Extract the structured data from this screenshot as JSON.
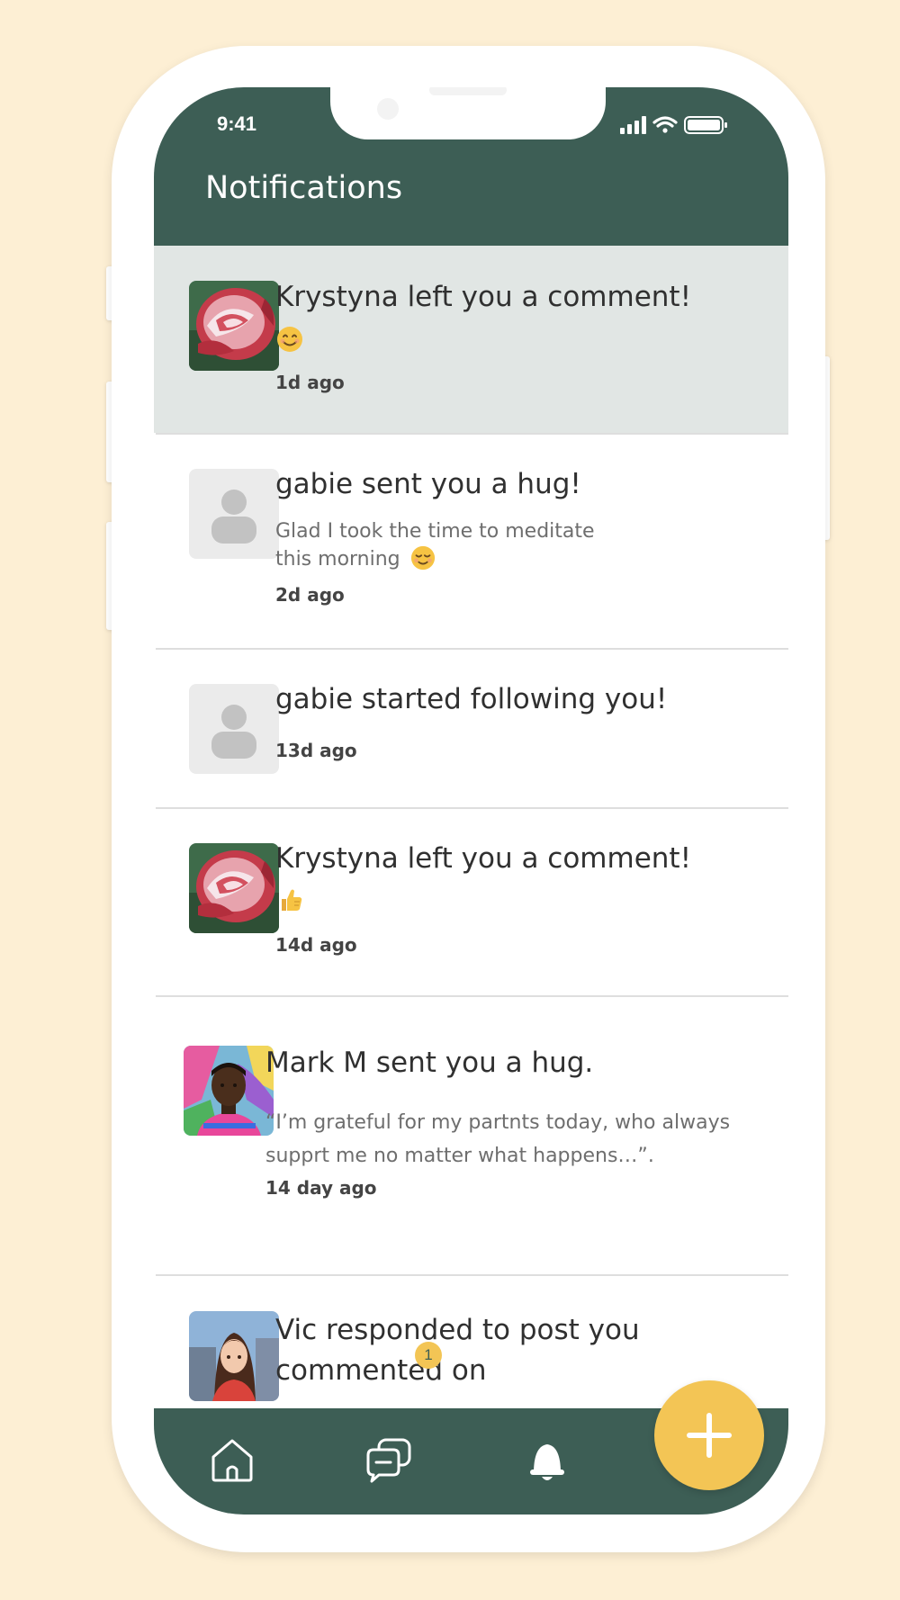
{
  "status": {
    "time": "9:41"
  },
  "header": {
    "title": "Notifications"
  },
  "notifications": [
    {
      "title": "Krystyna left you a comment!",
      "emoji": "smiling-face-emoji",
      "time": "1d ago",
      "unread": true,
      "avatar": "rose-photo"
    },
    {
      "title": "gabie sent you a hug!",
      "body_line1": "Glad I took the time to meditate",
      "body_line2": "this morning",
      "emoji": "relieved-face-emoji",
      "time": "2d ago",
      "avatar": "default-user"
    },
    {
      "title": "gabie started following you!",
      "time": "13d ago",
      "avatar": "default-user"
    },
    {
      "title": "Krystyna left you a comment!",
      "emoji": "thumbs-up-emoji",
      "time": "14d ago",
      "avatar": "rose-photo"
    },
    {
      "title": "Mark M sent you a hug.",
      "body_line1": "“I’m grateful for my partnts today, who always",
      "body_line2": "supprt me no matter what happens…”.",
      "time": "14 day ago",
      "avatar": "man-photo"
    },
    {
      "title_line1": "Vic responded to post you",
      "title_line2": "commented on",
      "avatar": "woman-illustration"
    }
  ],
  "tabbar": {
    "items": [
      "home-icon",
      "chat-icon",
      "bell-icon"
    ],
    "badge": "1",
    "fab_icon": "plus-icon"
  },
  "colors": {
    "background": "#fdefd4",
    "brand_green": "#3d5e55",
    "accent_yellow": "#f3c555",
    "unread_row": "#e1e6e4"
  }
}
